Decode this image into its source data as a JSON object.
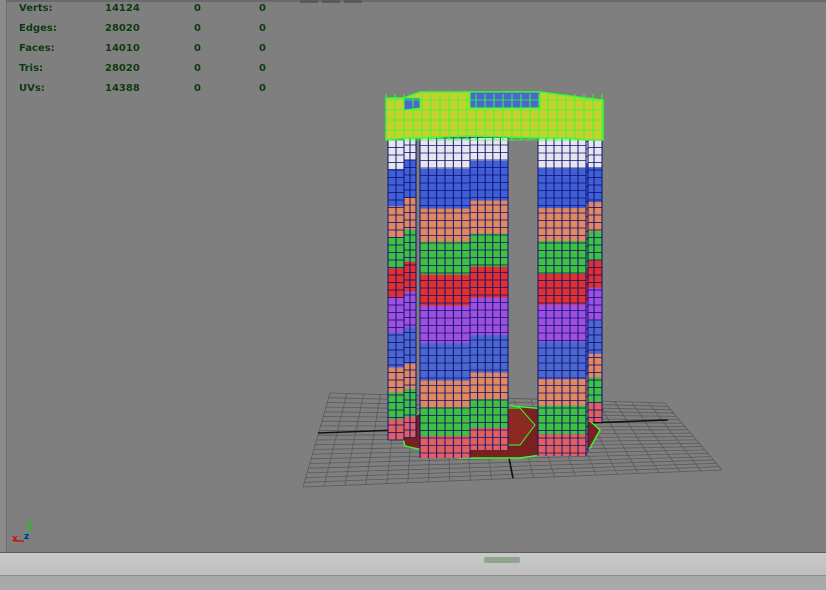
{
  "hud": {
    "rows": [
      {
        "label": "Verts:",
        "v1": "14124",
        "v2": "0",
        "v3": "0"
      },
      {
        "label": "Edges:",
        "v1": "28020",
        "v2": "0",
        "v3": "0"
      },
      {
        "label": "Faces:",
        "v1": "14010",
        "v2": "0",
        "v3": "0"
      },
      {
        "label": "Tris:",
        "v1": "28020",
        "v2": "0",
        "v3": "0"
      },
      {
        "label": "UVs:",
        "v1": "14388",
        "v2": "0",
        "v3": "0"
      }
    ]
  },
  "axis_indicator": {
    "x": "x",
    "y": "y",
    "z": "z"
  },
  "colors": {
    "viewport_bg": "#7f7f7f",
    "hud_text": "#0f3a0f",
    "wire_selected": "#33ff33",
    "wire_default": "#101070",
    "grid": "#5a5a5a",
    "axis_x": "#d01010",
    "axis_y": "#20c020",
    "axis_z": "#1020d0"
  }
}
